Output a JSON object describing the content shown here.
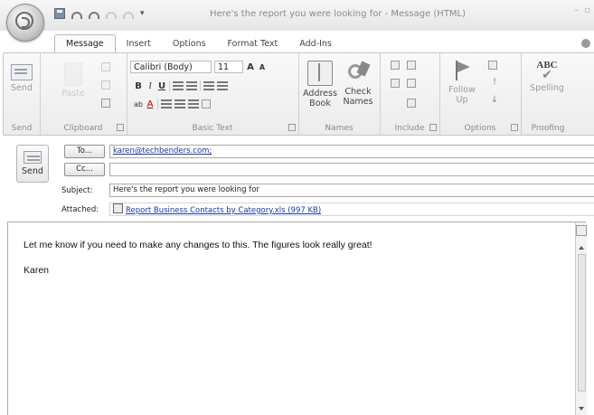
{
  "window": {
    "title": "Here's the report you were looking for - Message (HTML)"
  },
  "ribbon": {
    "tabs": [
      "Message",
      "Insert",
      "Options",
      "Format Text",
      "Add-Ins"
    ],
    "groups": {
      "send": {
        "button": "Send",
        "label": "Send"
      },
      "clipboard": {
        "paste": "Paste",
        "label": "Clipboard"
      },
      "basic_text": {
        "font": "Calibri (Body)",
        "size": "11",
        "label": "Basic Text"
      },
      "names": {
        "address_book": [
          "Address",
          "Book"
        ],
        "check_names": [
          "Check",
          "Names"
        ],
        "label": "Names"
      },
      "include": {
        "label": "Include"
      },
      "options": {
        "follow_up": [
          "Follow",
          "Up"
        ],
        "label": "Options"
      },
      "proofing": {
        "spelling_icon_text": "ABC",
        "spelling": "Spelling",
        "label": "Proofing"
      }
    }
  },
  "header": {
    "send_label": "Send",
    "to_button": "To...",
    "to_value": "karen@techbenders.com;",
    "cc_button": "Cc...",
    "cc_value": "",
    "subject_label": "Subject:",
    "subject_value": "Here's the report you were looking for",
    "attached_label": "Attached:",
    "attachment": "Report Business Contacts by Category.xls (997 KB)"
  },
  "body": {
    "line1": "Let me know if you need to make any changes to this.  The figures look really great!",
    "line2": "Karen"
  }
}
